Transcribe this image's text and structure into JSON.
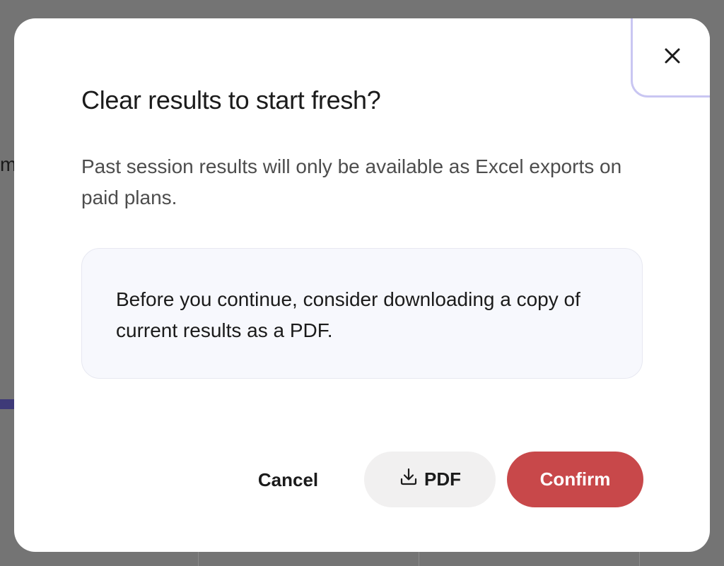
{
  "background": {
    "fragment_text": "m"
  },
  "dialog": {
    "title": "Clear results to start fresh?",
    "description": "Past session results will only be available as Excel exports on paid plans.",
    "info_box_text": "Before you continue, consider downloading a copy of current results as a PDF.",
    "close_icon": "close-icon",
    "buttons": {
      "cancel_label": "Cancel",
      "pdf_label": "PDF",
      "pdf_icon": "download-icon",
      "confirm_label": "Confirm"
    }
  },
  "colors": {
    "overlay": "#747474",
    "confirm": "#c8484a",
    "secondary_button": "#f1f0f0",
    "info_box": "#f7f8fd",
    "close_focus_ring": "#c9c6f2"
  }
}
